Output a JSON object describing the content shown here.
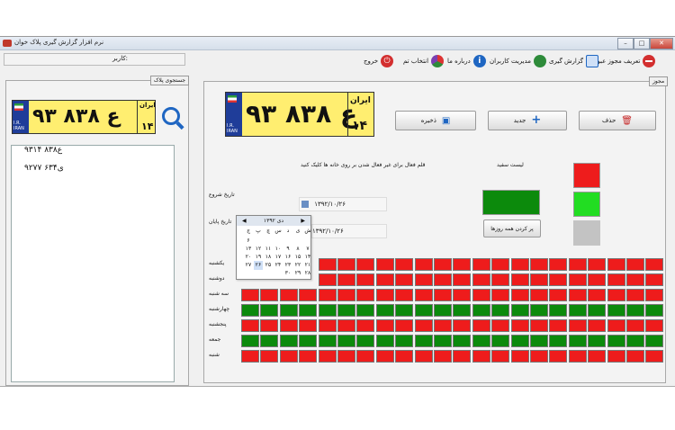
{
  "window": {
    "title": "نرم افزار گزارش گیری پلاک خوان",
    "controls": {
      "minimize": "–",
      "maximize": "□",
      "close": "✕"
    }
  },
  "toolbar": {
    "items": [
      {
        "label": "تعریف مجوز عبور",
        "icon": "no-entry-icon",
        "color": "#d32f2f"
      },
      {
        "label": "گزارش گیری",
        "icon": "pencil-note-icon",
        "color": "#1f66c2"
      },
      {
        "label": "مدیریت کاربران",
        "icon": "users-icon",
        "color": "#2e8b3a"
      },
      {
        "label": "درباره ما",
        "icon": "info-icon",
        "color": "#1f66c2"
      },
      {
        "label": "انتخاب تم",
        "icon": "theme-icon",
        "color": "#7a3fb0"
      },
      {
        "label": "خروج",
        "icon": "power-icon",
        "color": "#d32f2f"
      }
    ],
    "user_label": "کاربر:"
  },
  "search_panel": {
    "legend": "جستجوی پلاک",
    "plate": {
      "digits": "۹۳ ع ۸۳۸",
      "country": "ایران",
      "code": "۱۴",
      "ir": "I.R. IRAN"
    },
    "results": [
      "۹۳ع۸۳۸ ۱۴",
      "۹۲ی۶۳۴ ۷۷"
    ]
  },
  "pass_panel": {
    "legend": "مجوز",
    "plate": {
      "digits": "۹۳ ع ۸۳۸",
      "country": "ایران",
      "code": "۱۴",
      "ir": "I.R. IRAN"
    },
    "buttons": {
      "delete": "حذف",
      "new": "جدید",
      "save": "ذخیره"
    },
    "hint": "قلم فعال برای غیر فعال شدن بر روی خانه ها کلیک کنید",
    "blacklist_label": "لیست سفید",
    "start_label": "تاریخ شروع",
    "end_label": "تاریخ پایان",
    "start_date": "۱۳۹۲/۱۰/۲۶",
    "end_date": "۱۳۹۲/۱۰/۲۶",
    "fill_all_button": "پر کردن همه روزها",
    "colors": {
      "red": "#ee1c1c",
      "green": "#0c8a0c",
      "light_green": "#22dd22",
      "gray": "#c3c3c3"
    }
  },
  "calendar": {
    "month": "دی ۱۳۹۲",
    "weekdays": [
      "ش",
      "ی",
      "د",
      "س",
      "چ",
      "پ",
      "ج"
    ],
    "rows": [
      [
        "",
        "",
        "",
        "",
        "",
        "",
        "۶"
      ],
      [
        "۷",
        "۸",
        "۹",
        "۱۰",
        "۱۱",
        "۱۲",
        "۱۳"
      ],
      [
        "۱۴",
        "۱۵",
        "۱۶",
        "۱۷",
        "۱۸",
        "۱۹",
        "۲۰"
      ],
      [
        "۲۱",
        "۲۲",
        "۲۳",
        "۲۴",
        "۲۵",
        "۲۶",
        "۲۷"
      ],
      [
        "۲۸",
        "۲۹",
        "۳۰",
        "",
        "",
        "",
        ""
      ]
    ],
    "selected": "۲۶"
  },
  "schedule": {
    "days": [
      "یکشنبه",
      "دوشنبه",
      "سه شنبه",
      "چهارشنبه",
      "پنجشنبه",
      "جمعه",
      "شنبه"
    ],
    "row_states": [
      "red",
      "red",
      "red",
      "green",
      "red",
      "green",
      "red"
    ]
  }
}
